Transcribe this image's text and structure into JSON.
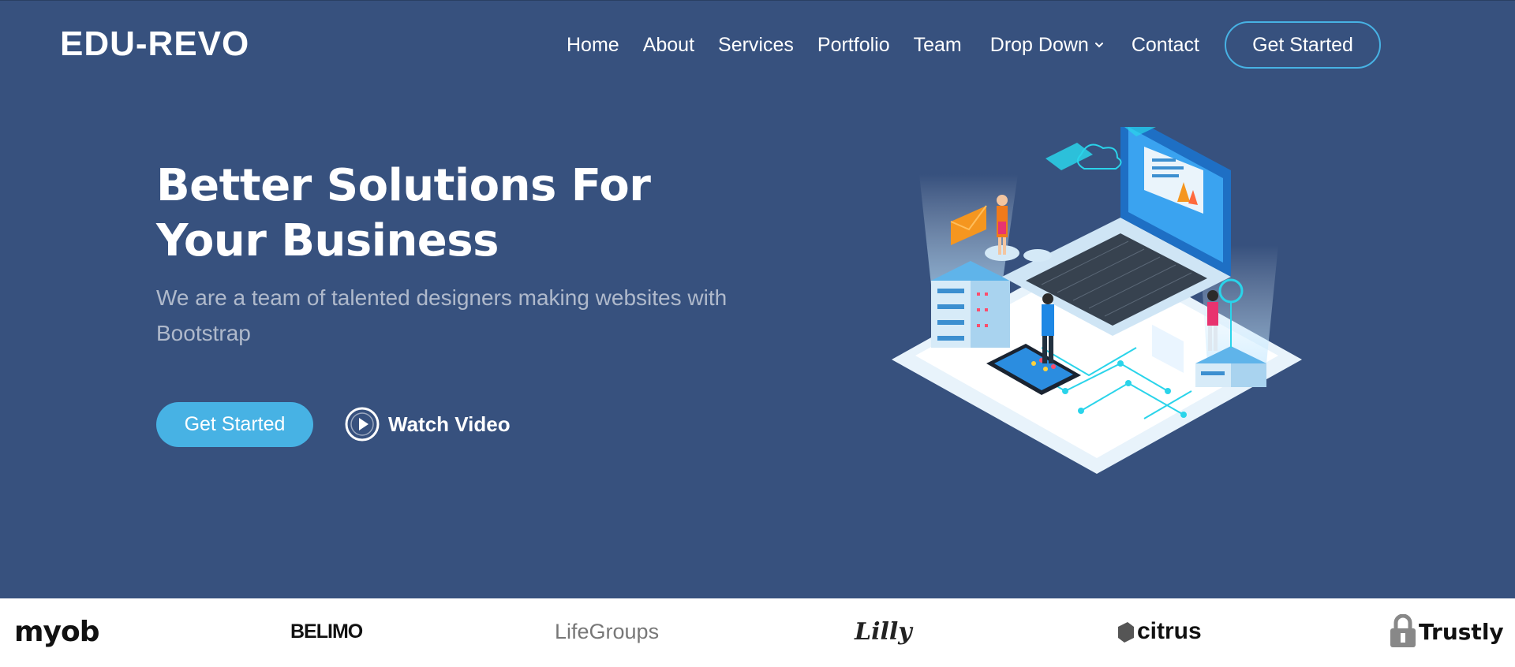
{
  "brand": {
    "name": "EDU-REVO"
  },
  "nav": {
    "items": [
      "Home",
      "About",
      "Services",
      "Portfolio",
      "Team"
    ],
    "dropdown_label": "Drop Down",
    "contact_label": "Contact",
    "cta_label": "Get Started"
  },
  "hero": {
    "title_line1": "Better Solutions For",
    "title_line2": "Your Business",
    "subtitle": "We are a team of talented designers making websites with Bootstrap",
    "primary_button": "Get Started",
    "video_link": "Watch Video"
  },
  "clients": [
    "myob",
    "BELIMO",
    "LifeGroups",
    "Lilly",
    "citrus",
    "Trustly"
  ],
  "colors": {
    "hero_bg": "#37517e",
    "accent": "#47b2e4",
    "white": "#ffffff"
  },
  "icons": {
    "dropdown": "chevron-down-icon",
    "video": "play-circle-icon"
  }
}
